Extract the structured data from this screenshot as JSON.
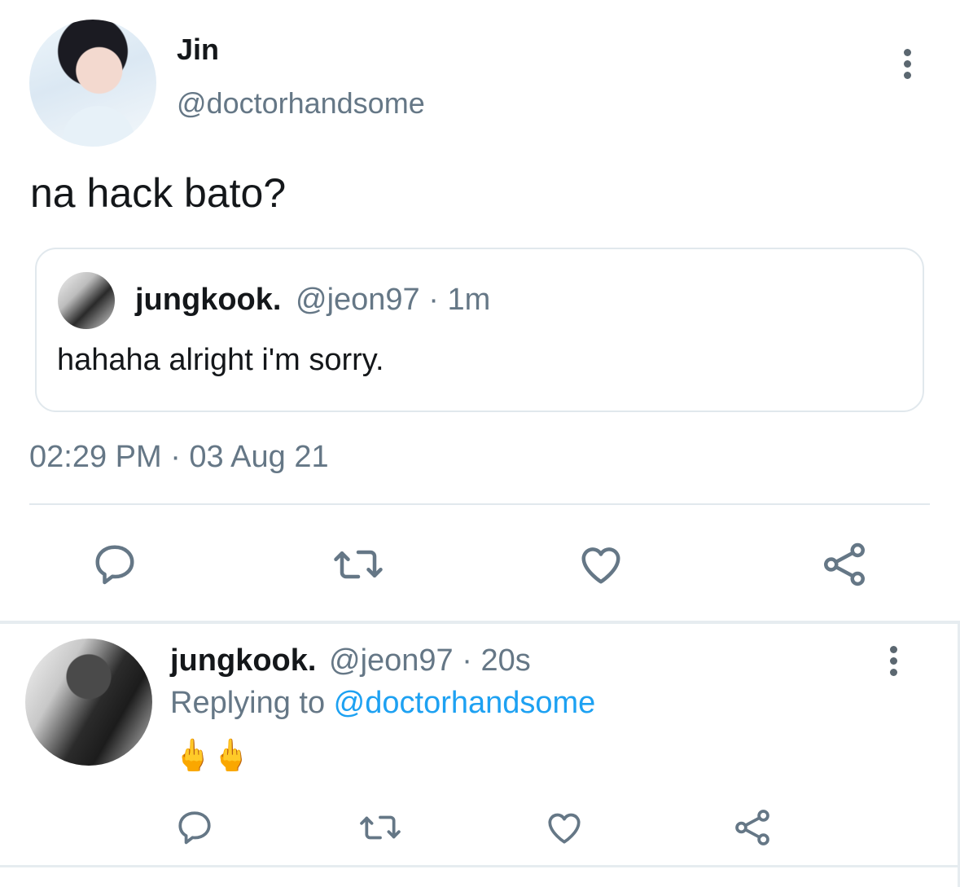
{
  "main_tweet": {
    "author_name": "Jin",
    "author_handle": "@doctorhandsome",
    "text": "na hack bato?",
    "quoted": {
      "author_name": "jungkook.",
      "meta": "@jeon97 · 1m",
      "text": "hahaha alright i'm sorry."
    },
    "timestamp": "02:29 PM · 03 Aug 21"
  },
  "reply": {
    "author_name": "jungkook.",
    "meta": "@jeon97 · 20s",
    "replying_prefix": "Replying to ",
    "replying_mention": "@doctorhandsome",
    "text": "🖕🖕"
  },
  "icons": {
    "reply": "reply-icon",
    "retweet": "retweet-icon",
    "like": "heart-icon",
    "share": "share-icon",
    "more": "more-vertical-icon"
  },
  "colors": {
    "text": "#14171a",
    "muted": "#657786",
    "accent": "#1da1f2",
    "divider": "#e1e8ed"
  }
}
